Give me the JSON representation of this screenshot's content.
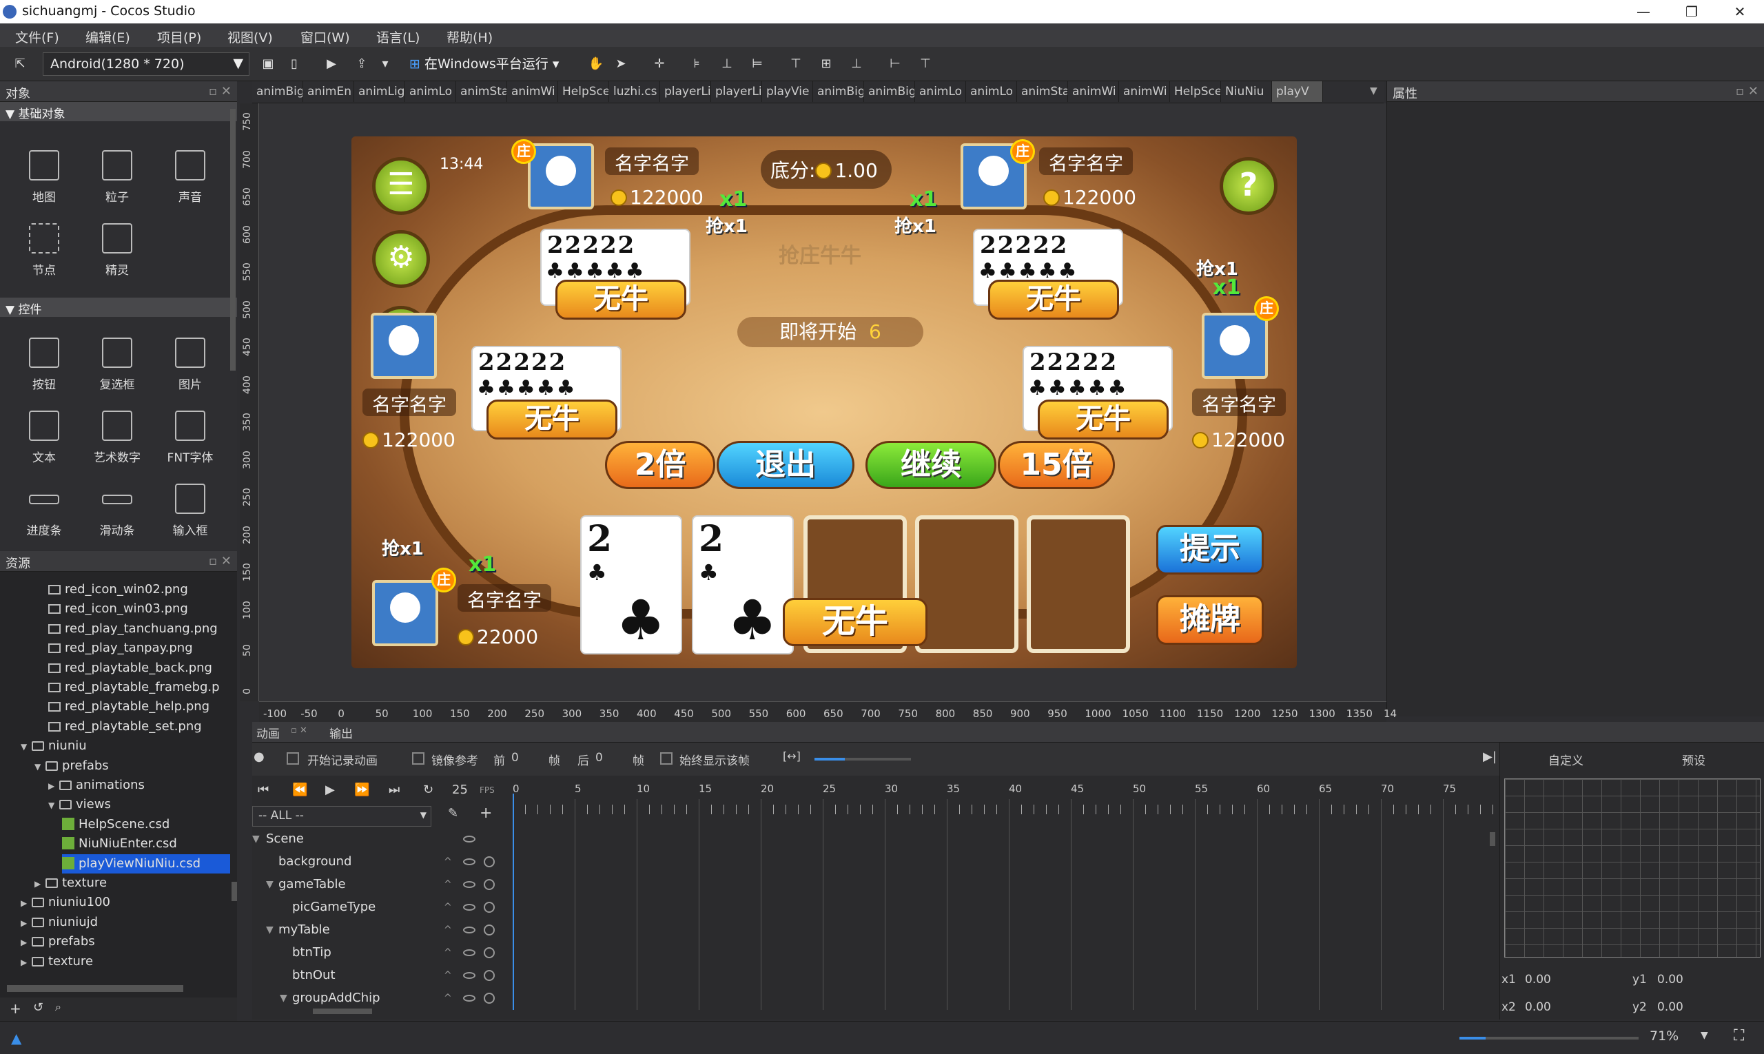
{
  "window": {
    "title": "sichuangmj - Cocos Studio",
    "min": "—",
    "max": "❐",
    "close": "✕"
  },
  "menu": [
    "文件(F)",
    "编辑(E)",
    "项目(P)",
    "视图(V)",
    "窗口(W)",
    "语言(L)",
    "帮助(H)"
  ],
  "toolbar": {
    "resolution": "Android(1280 * 720)",
    "run": "在Windows平台运行"
  },
  "objects_panel": {
    "title": "对象",
    "basic_header": "基础对象",
    "basic": [
      "地图",
      "粒子",
      "声音",
      "节点",
      "精灵"
    ],
    "controls_header": "控件",
    "controls": [
      "按钮",
      "复选框",
      "图片",
      "文本",
      "艺术数字",
      "FNT字体",
      "进度条",
      "滑动条",
      "输入框"
    ]
  },
  "resources_panel": {
    "title": "资源",
    "items": [
      {
        "name": "red_icon_win02.png",
        "indent": 3,
        "type": "img"
      },
      {
        "name": "red_icon_win03.png",
        "indent": 3,
        "type": "img"
      },
      {
        "name": "red_play_tanchuang.png",
        "indent": 3,
        "type": "img"
      },
      {
        "name": "red_play_tanpay.png",
        "indent": 3,
        "type": "img"
      },
      {
        "name": "red_playtable_back.png",
        "indent": 3,
        "type": "img"
      },
      {
        "name": "red_playtable_framebg.p",
        "indent": 3,
        "type": "img"
      },
      {
        "name": "red_playtable_help.png",
        "indent": 3,
        "type": "img"
      },
      {
        "name": "red_playtable_set.png",
        "indent": 3,
        "type": "img"
      },
      {
        "name": "niuniu",
        "indent": 1,
        "type": "folder",
        "arrow": "▼"
      },
      {
        "name": "prefabs",
        "indent": 2,
        "type": "folder",
        "arrow": "▼"
      },
      {
        "name": "animations",
        "indent": 3,
        "type": "folder",
        "arrow": "▶"
      },
      {
        "name": "views",
        "indent": 3,
        "type": "folder",
        "arrow": "▼"
      },
      {
        "name": "HelpScene.csd",
        "indent": 4,
        "type": "csd"
      },
      {
        "name": "NiuNiuEnter.csd",
        "indent": 4,
        "type": "csd"
      },
      {
        "name": "playViewNiuNiu.csd",
        "indent": 4,
        "type": "csd",
        "selected": true
      },
      {
        "name": "texture",
        "indent": 2,
        "type": "folder",
        "arrow": "▶"
      },
      {
        "name": "niuniu100",
        "indent": 1,
        "type": "folder",
        "arrow": "▶"
      },
      {
        "name": "niuniujd",
        "indent": 1,
        "type": "folder",
        "arrow": "▶"
      },
      {
        "name": "prefabs",
        "indent": 1,
        "type": "folder",
        "arrow": "▶"
      },
      {
        "name": "texture",
        "indent": 1,
        "type": "folder",
        "arrow": "▶"
      }
    ]
  },
  "tabs": [
    "animBig",
    "animEn",
    "animLig",
    "animLo",
    "animSta",
    "animWi",
    "HelpSce",
    "luzhi.cs",
    "playerLi",
    "playerLi",
    "playVie",
    "animBig",
    "animBig",
    "animLo",
    "animLo",
    "animSta",
    "animWi",
    "animWi",
    "HelpSce",
    "NiuNiu",
    "playV"
  ],
  "properties_panel": {
    "title": "属性"
  },
  "scene": {
    "time": "13:44",
    "difen_label": "底分:",
    "difen_value": "1.00",
    "title": "抢庄牛牛",
    "starting": "即将开始",
    "countdown": "6",
    "name": "名字名字",
    "coins": "122000",
    "coins_bottom": "22000",
    "zhuang": "庄",
    "qiang": "抢",
    "x1": "x1",
    "hand": "22222",
    "wuniu": "无牛",
    "card_rank": "2",
    "club": "♣",
    "btn_2x": "2倍",
    "btn_exit": "退出",
    "btn_continue": "继续",
    "btn_15x": "15倍",
    "btn_tip": "提示",
    "btn_show": "摊牌"
  },
  "hruler": [
    "-100",
    "-50",
    "0",
    "50",
    "100",
    "150",
    "200",
    "250",
    "300",
    "350",
    "400",
    "450",
    "500",
    "550",
    "600",
    "650",
    "700",
    "750",
    "800",
    "850",
    "900",
    "950",
    "1000",
    "1050",
    "1100",
    "1150",
    "1200",
    "1250",
    "1300",
    "1350",
    "14"
  ],
  "vruler": [
    "750",
    "700",
    "650",
    "600",
    "550",
    "500",
    "450",
    "400",
    "350",
    "300",
    "250",
    "200",
    "150",
    "100",
    "50",
    "0"
  ],
  "bottom_tabs": {
    "animation": "动画",
    "output": "输出"
  },
  "timeline": {
    "record": "开始记录动画",
    "mirror": "镜像参考",
    "prev": "前",
    "prev_val": "0",
    "frame": "帧",
    "next": "后",
    "next_val": "0",
    "frame2": "帧",
    "always": "始终显示该帧",
    "fps": "25",
    "fps_label": "FPS",
    "filter": "-- ALL --",
    "ticks": [
      "0",
      "5",
      "10",
      "15",
      "20",
      "25",
      "30",
      "35",
      "40",
      "45",
      "50",
      "55",
      "60",
      "65",
      "70",
      "75"
    ],
    "rows": [
      {
        "name": "Scene",
        "indent": 0
      },
      {
        "name": "background",
        "indent": 1
      },
      {
        "name": "gameTable",
        "indent": 1
      },
      {
        "name": "picGameType",
        "indent": 2
      },
      {
        "name": "myTable",
        "indent": 1
      },
      {
        "name": "btnTip",
        "indent": 2
      },
      {
        "name": "btnOut",
        "indent": 2
      },
      {
        "name": "groupAddChip",
        "indent": 2
      }
    ]
  },
  "curve": {
    "custom": "自定义",
    "preset": "预设",
    "x1": "x1",
    "x1v": "0.00",
    "y1": "y1",
    "y1v": "0.00",
    "x2": "x2",
    "x2v": "0.00",
    "y2": "y2",
    "y2v": "0.00"
  },
  "status": {
    "zoom": "71%"
  }
}
